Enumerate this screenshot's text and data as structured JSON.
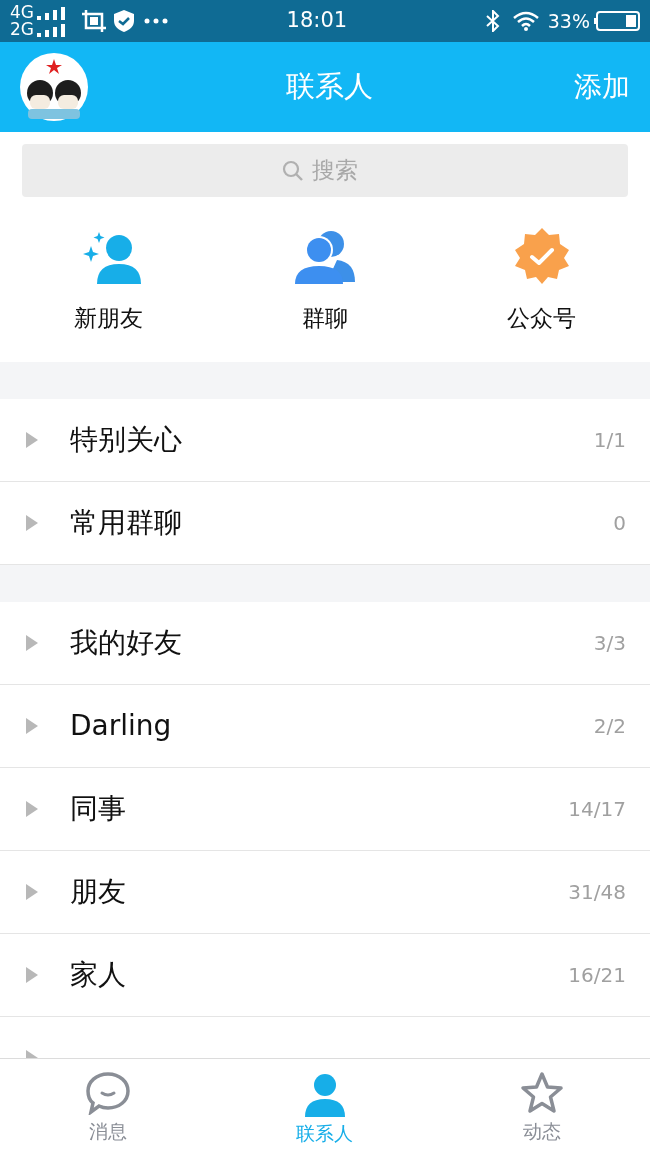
{
  "status_bar": {
    "networks": [
      "4G",
      "2G"
    ],
    "time": "18:01",
    "battery": "33%"
  },
  "header": {
    "title": "联系人",
    "action": "添加"
  },
  "search": {
    "placeholder": "搜索"
  },
  "shortcuts": [
    {
      "kind": "new-friend",
      "label": "新朋友"
    },
    {
      "kind": "group-chat",
      "label": "群聊"
    },
    {
      "kind": "official",
      "label": "公众号"
    }
  ],
  "sections": [
    [
      {
        "name": "特别关心",
        "count": "1/1"
      },
      {
        "name": "常用群聊",
        "count": "0"
      }
    ],
    [
      {
        "name": "我的好友",
        "count": "3/3"
      },
      {
        "name": "Darling",
        "count": "2/2"
      },
      {
        "name": "同事",
        "count": "14/17"
      },
      {
        "name": "朋友",
        "count": "31/48"
      },
      {
        "name": "家人",
        "count": "16/21"
      }
    ]
  ],
  "tabs": [
    {
      "kind": "message",
      "label": "消息",
      "selected": false
    },
    {
      "kind": "contacts",
      "label": "联系人",
      "selected": true
    },
    {
      "kind": "feed",
      "label": "动态",
      "selected": false
    }
  ]
}
